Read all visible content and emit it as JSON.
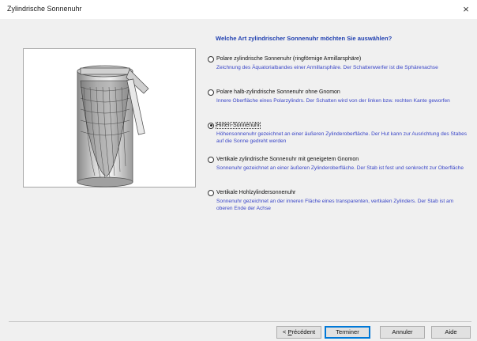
{
  "window": {
    "title": "Zylindrische Sonnenuhr",
    "close_glyph": "×"
  },
  "question": "Welche Art zylindrischer Sonnenuhr möchten Sie auswählen?",
  "options": [
    {
      "label": "Polare zylindrische Sonnenuhr (ringförmige Armillarsphäre)",
      "description": "Zeichnung des Äquatorialbandes einer Armillarsphäre. Der Schattenwerfer ist die Sphärenachse",
      "checked": false
    },
    {
      "label": "Polare halb-zylindrische Sonnenuhr ohne Gnomon",
      "description": "Innere Oberfläche eines Polarzylindrs. Der Schatten wird von der linken bzw. rechten Kante geworfen",
      "checked": false
    },
    {
      "label": "Hirten-Sonnenuhr",
      "description": "Höhensonnenuhr gezeichnet an einer äußeren Zylinderoberfläche. Der Hut kann zur Ausrichtung des Stabes auf die Sonne gedreht werden",
      "checked": true
    },
    {
      "label": "Vertikale zylindrische Sonnenuhr mit geneigetem Gnomon",
      "description": "Sonnenuhr gezeichnet an einer äußeren Zylinderoberfläche. Der Stab ist fest und senkrecht zur Oberfläche",
      "checked": false
    },
    {
      "label": "Vertikale Hohlzylindersonnenuhr",
      "description": "Sonnenuhr gezeichnet an der inneren Fläche eines transparenten, vertkalen Zylinders. Der Stab ist am oberen Ende der Achse",
      "checked": false
    }
  ],
  "buttons": {
    "back_prefix": "< ",
    "back_mnemonic": "P",
    "back_rest": "récédent",
    "finish": "Terminer",
    "cancel": "Annuler",
    "help": "Aide"
  },
  "preview": {
    "icon": "shepherd-sundial-illustration"
  }
}
